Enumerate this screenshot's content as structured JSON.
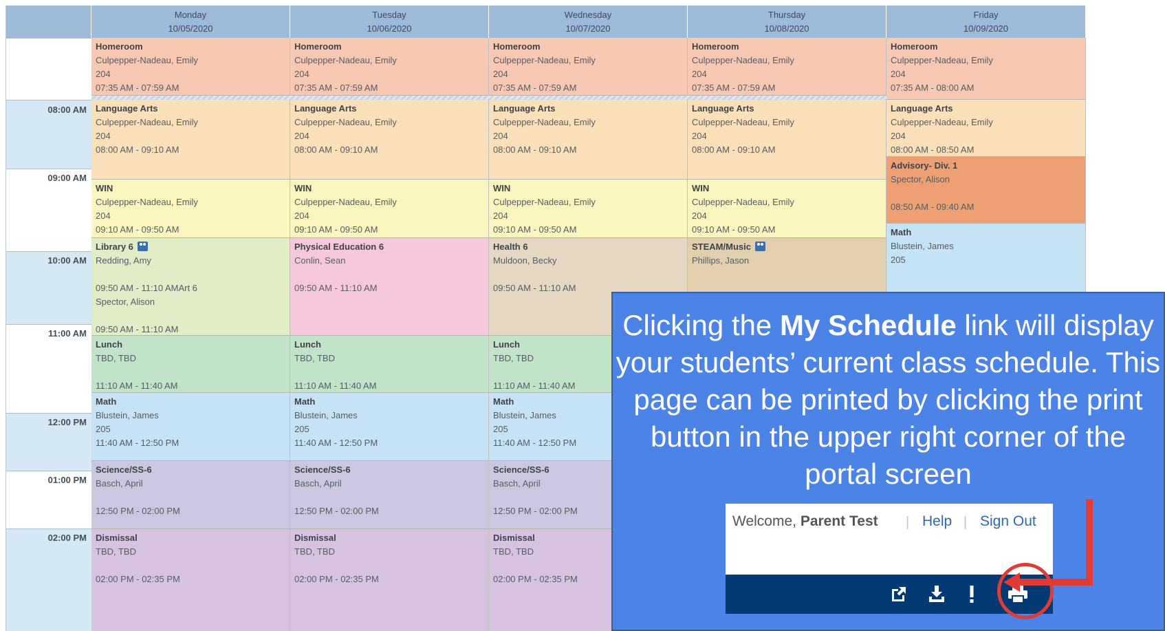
{
  "days": [
    {
      "name": "Monday",
      "date": "10/05/2020"
    },
    {
      "name": "Tuesday",
      "date": "10/06/2020"
    },
    {
      "name": "Wednesday",
      "date": "10/07/2020"
    },
    {
      "name": "Thursday",
      "date": "10/08/2020"
    },
    {
      "name": "Friday",
      "date": "10/09/2020"
    }
  ],
  "times": [
    "08:00 AM",
    "09:00 AM",
    "10:00 AM",
    "11:00 AM",
    "12:00 PM",
    "01:00 PM",
    "02:00 PM"
  ],
  "colors": {
    "homeroom": "#f7c9b3",
    "language": "#fbe0b9",
    "win": "#fbf5c0",
    "advisory": "#ee9f73",
    "library": "#e1edc5",
    "pe": "#f6c8dc",
    "health": "#e6d7c2",
    "steam": "#e2cfae",
    "lunch": "#c1e3c7",
    "math": "#c6e2f5",
    "science": "#ccc7e0",
    "dismissal": "#d7c3e0",
    "header": "#9cbbd9"
  },
  "schedule": {
    "monday": {
      "homeroom": {
        "title": "Homeroom",
        "teacher": "Culpepper-Nadeau, Emily",
        "room": "204",
        "time": "07:35 AM - 07:59 AM"
      },
      "language_arts": {
        "title": "Language Arts",
        "teacher": "Culpepper-Nadeau, Emily",
        "room": "204",
        "time": "08:00 AM - 09:10 AM"
      },
      "win": {
        "title": "WIN",
        "teacher": "Culpepper-Nadeau, Emily",
        "room": "204",
        "time": "09:10 AM - 09:50 AM"
      },
      "library": {
        "title": "Library 6",
        "teacher": "Redding, Amy",
        "time": "09:50 AM - 11:10 AMArt 6",
        "teacher2": "Spector, Alison",
        "time2": "09:50 AM - 11:10 AM"
      },
      "lunch": {
        "title": "Lunch",
        "teacher": "TBD, TBD",
        "time": "11:10 AM - 11:40 AM"
      },
      "math": {
        "title": "Math",
        "teacher": "Blustein, James",
        "room": "205",
        "time": "11:40 AM - 12:50 PM"
      },
      "science": {
        "title": "Science/SS-6",
        "teacher": "Basch, April",
        "time": "12:50 PM - 02:00 PM"
      },
      "dismissal": {
        "title": "Dismissal",
        "teacher": "TBD, TBD",
        "time": "02:00 PM - 02:35 PM"
      }
    },
    "tuesday": {
      "homeroom": {
        "title": "Homeroom",
        "teacher": "Culpepper-Nadeau, Emily",
        "room": "204",
        "time": "07:35 AM - 07:59 AM"
      },
      "language_arts": {
        "title": "Language Arts",
        "teacher": "Culpepper-Nadeau, Emily",
        "room": "204",
        "time": "08:00 AM - 09:10 AM"
      },
      "win": {
        "title": "WIN",
        "teacher": "Culpepper-Nadeau, Emily",
        "room": "204",
        "time": "09:10 AM - 09:50 AM"
      },
      "pe": {
        "title": "Physical Education 6",
        "teacher": "Conlin, Sean",
        "time": "09:50 AM - 11:10 AM"
      },
      "lunch": {
        "title": "Lunch",
        "teacher": "TBD, TBD",
        "time": "11:10 AM - 11:40 AM"
      },
      "math": {
        "title": "Math",
        "teacher": "Blustein, James",
        "room": "205",
        "time": "11:40 AM - 12:50 PM"
      },
      "science": {
        "title": "Science/SS-6",
        "teacher": "Basch, April",
        "time": "12:50 PM - 02:00 PM"
      },
      "dismissal": {
        "title": "Dismissal",
        "teacher": "TBD, TBD",
        "time": "02:00 PM - 02:35 PM"
      }
    },
    "wednesday": {
      "homeroom": {
        "title": "Homeroom",
        "teacher": "Culpepper-Nadeau, Emily",
        "room": "204",
        "time": "07:35 AM - 07:59 AM"
      },
      "language_arts": {
        "title": "Language Arts",
        "teacher": "Culpepper-Nadeau, Emily",
        "room": "204",
        "time": "08:00 AM - 09:10 AM"
      },
      "win": {
        "title": "WIN",
        "teacher": "Culpepper-Nadeau, Emily",
        "room": "204",
        "time": "09:10 AM - 09:50 AM"
      },
      "health": {
        "title": "Health 6",
        "teacher": "Muldoon, Becky",
        "time": "09:50 AM - 11:10 AM"
      },
      "lunch": {
        "title": "Lunch",
        "teacher": "TBD, TBD",
        "time": "11:10 AM - 11:40 AM"
      },
      "math": {
        "title": "Math",
        "teacher": "Blustein, James",
        "room": "205",
        "time": "11:40 AM - 12:50 PM"
      },
      "science": {
        "title": "Science/SS-6",
        "teacher": "Basch, April",
        "time": "12:50 PM - 02:00 PM"
      },
      "dismissal": {
        "title": "Dismissal",
        "teacher": "TBD, TBD",
        "time": "02:00 PM - 02:35 PM"
      }
    },
    "thursday": {
      "homeroom": {
        "title": "Homeroom",
        "teacher": "Culpepper-Nadeau, Emily",
        "room": "204",
        "time": "07:35 AM - 07:59 AM"
      },
      "language_arts": {
        "title": "Language Arts",
        "teacher": "Culpepper-Nadeau, Emily",
        "room": "204",
        "time": "08:00 AM - 09:10 AM"
      },
      "win": {
        "title": "WIN",
        "teacher": "Culpepper-Nadeau, Emily",
        "room": "204",
        "time": "09:10 AM - 09:50 AM"
      },
      "steam": {
        "title": "STEAM/Music",
        "teacher": "Phillips, Jason"
      }
    },
    "friday": {
      "homeroom": {
        "title": "Homeroom",
        "teacher": "Culpepper-Nadeau, Emily",
        "room": "204",
        "time": "07:35 AM - 08:00 AM"
      },
      "language_arts": {
        "title": "Language Arts",
        "teacher": "Culpepper-Nadeau, Emily",
        "room": "204",
        "time": "08:00 AM - 08:50 AM"
      },
      "advisory": {
        "title": "Advisory- Div. 1",
        "teacher": "Spector, Alison",
        "time": "08:50 AM - 09:40 AM"
      },
      "math": {
        "title": "Math",
        "teacher": "Blustein, James",
        "room": "205"
      }
    }
  },
  "callout": {
    "text_before": "Clicking the ",
    "text_bold": "My Schedule",
    "text_after": " link will display your students’ current class schedule. This page can be printed by clicking the print button in the upper right corner of the portal screen"
  },
  "portal": {
    "welcome_prefix": "Welcome, ",
    "welcome_name": "Parent Test",
    "help": "Help",
    "sign_out": "Sign Out",
    "separator": "|",
    "toolbar_icons": [
      "external-link-icon",
      "download-icon",
      "alert-icon",
      "print-icon"
    ]
  }
}
